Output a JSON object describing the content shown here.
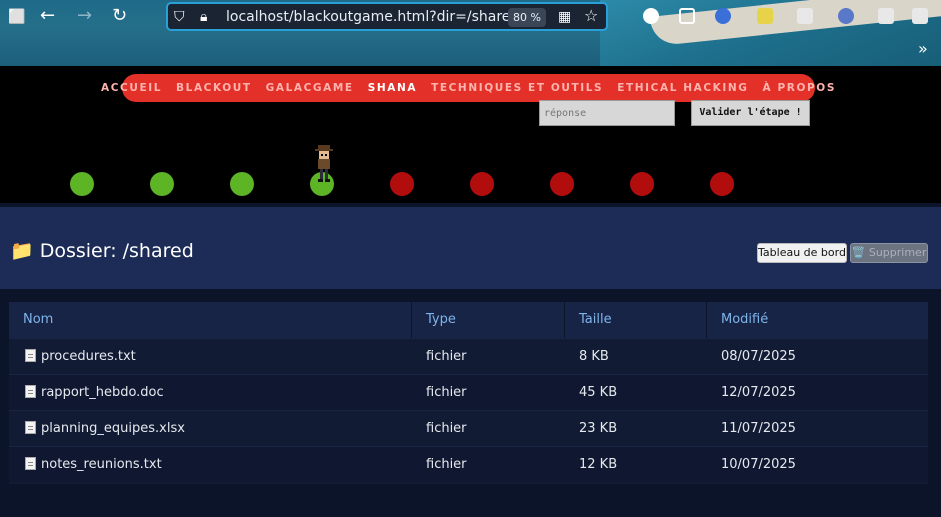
{
  "browser": {
    "url": "localhost/blackoutgame.html?dir=/shared",
    "zoom": "80 %"
  },
  "game": {
    "nav": [
      {
        "label": "ACCUEIL",
        "active": false
      },
      {
        "label": "BLACKOUT",
        "active": false
      },
      {
        "label": "GALACGAME",
        "active": false
      },
      {
        "label": "SHANA",
        "active": true
      },
      {
        "label": "TECHNIQUES ET OUTILS",
        "active": false
      },
      {
        "label": "ETHICAL HACKING",
        "active": false
      },
      {
        "label": "À PROPOS",
        "active": false
      }
    ],
    "answer_placeholder": "réponse",
    "validate_label": "Valider l'étape !",
    "progress": {
      "completed_steps": 4,
      "total_steps": 9
    },
    "colors": {
      "done": "#5db424",
      "todo": "#b10d0d",
      "nav": "#e3312a"
    }
  },
  "file_manager": {
    "title": "📁 Dossier: /shared",
    "dashboard_label": "Tableau de bord",
    "delete_label": "🗑️ Supprimer",
    "columns": [
      "Nom",
      "Type",
      "Taille",
      "Modifié"
    ],
    "rows": [
      {
        "name": "procedures.txt",
        "type": "fichier",
        "size": "8 KB",
        "modified": "08/07/2025"
      },
      {
        "name": "rapport_hebdo.doc",
        "type": "fichier",
        "size": "45 KB",
        "modified": "12/07/2025"
      },
      {
        "name": "planning_equipes.xlsx",
        "type": "fichier",
        "size": "23 KB",
        "modified": "11/07/2025"
      },
      {
        "name": "notes_reunions.txt",
        "type": "fichier",
        "size": "12 KB",
        "modified": "10/07/2025"
      }
    ]
  }
}
